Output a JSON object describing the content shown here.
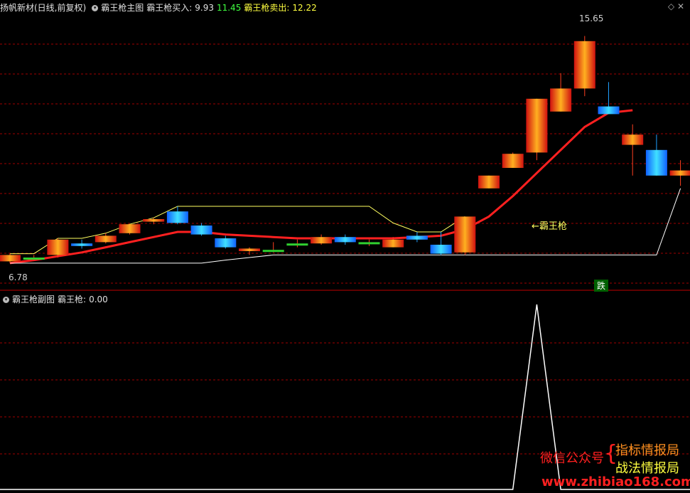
{
  "header": {
    "stock": "扬帆新材(日线,前复权)",
    "indicator": "霸王枪主图",
    "buy_label": "霸王枪买入:",
    "buy_value": "9.93",
    "mid_value": "11.45",
    "sell_label": "霸王枪卖出:",
    "sell_value": "12.22"
  },
  "sub_header": {
    "indicator": "霸王枪副图",
    "value_label": "霸王枪:",
    "value": "0.00"
  },
  "annotations": {
    "high": "15.65",
    "low": "6.78",
    "line_label": "←霸王枪",
    "signal": "跌"
  },
  "watermark": {
    "wechat": "微信公众号",
    "brand1": "指标情报局",
    "brand2": "战法情报局",
    "url": "www.zhibiao168.com"
  },
  "colors": {
    "up": "#ff3020",
    "down": "#20a0ff",
    "flat": "#30d030",
    "ma": "#ff2020",
    "white_line": "#ffffff",
    "yellow_line": "#ffff60",
    "grid": "#a00000"
  },
  "chart_data": {
    "type": "candlestick",
    "price_range": [
      6.0,
      16.5
    ],
    "candles": [
      {
        "o": 6.85,
        "h": 7.15,
        "l": 6.78,
        "c": 7.1
      },
      {
        "o": 7.0,
        "h": 7.1,
        "l": 6.9,
        "c": 7.0
      },
      {
        "o": 7.1,
        "h": 7.75,
        "l": 7.0,
        "c": 7.7
      },
      {
        "o": 7.55,
        "h": 7.7,
        "l": 7.35,
        "c": 7.45
      },
      {
        "o": 7.6,
        "h": 7.95,
        "l": 7.55,
        "c": 7.85
      },
      {
        "o": 7.95,
        "h": 8.3,
        "l": 7.9,
        "c": 8.3
      },
      {
        "o": 8.4,
        "h": 8.55,
        "l": 8.3,
        "c": 8.5
      },
      {
        "o": 8.8,
        "h": 9.0,
        "l": 8.3,
        "c": 8.35
      },
      {
        "o": 8.25,
        "h": 8.35,
        "l": 7.85,
        "c": 7.9
      },
      {
        "o": 7.75,
        "h": 7.85,
        "l": 7.35,
        "c": 7.4
      },
      {
        "o": 7.25,
        "h": 7.4,
        "l": 7.1,
        "c": 7.35
      },
      {
        "o": 7.3,
        "h": 7.6,
        "l": 7.2,
        "c": 7.3
      },
      {
        "o": 7.5,
        "h": 7.7,
        "l": 7.4,
        "c": 7.55
      },
      {
        "o": 7.55,
        "h": 7.9,
        "l": 7.5,
        "c": 7.8
      },
      {
        "o": 7.8,
        "h": 7.9,
        "l": 7.5,
        "c": 7.6
      },
      {
        "o": 7.6,
        "h": 7.7,
        "l": 7.45,
        "c": 7.6
      },
      {
        "o": 7.4,
        "h": 7.8,
        "l": 7.4,
        "c": 7.7
      },
      {
        "o": 7.85,
        "h": 8.0,
        "l": 7.6,
        "c": 7.7
      },
      {
        "o": 7.5,
        "h": 8.0,
        "l": 7.1,
        "c": 7.15
      },
      {
        "o": 7.2,
        "h": 8.6,
        "l": 7.1,
        "c": 8.6
      },
      {
        "o": 9.7,
        "h": 10.2,
        "l": 9.7,
        "c": 10.2
      },
      {
        "o": 10.5,
        "h": 11.1,
        "l": 10.5,
        "c": 11.05
      },
      {
        "o": 11.1,
        "h": 13.2,
        "l": 10.8,
        "c": 13.2
      },
      {
        "o": 12.7,
        "h": 14.2,
        "l": 12.7,
        "c": 13.6
      },
      {
        "o": 13.6,
        "h": 15.65,
        "l": 13.3,
        "c": 15.45
      },
      {
        "o": 12.9,
        "h": 13.85,
        "l": 12.6,
        "c": 12.6
      },
      {
        "o": 11.4,
        "h": 12.2,
        "l": 10.2,
        "c": 11.8
      },
      {
        "o": 11.2,
        "h": 11.8,
        "l": 10.2,
        "c": 10.2
      },
      {
        "o": 10.2,
        "h": 10.8,
        "l": 9.8,
        "c": 10.4
      }
    ],
    "ma_line": [
      6.78,
      6.9,
      7.05,
      7.2,
      7.4,
      7.6,
      7.8,
      8.0,
      8.0,
      7.9,
      7.85,
      7.8,
      7.75,
      7.75,
      7.75,
      7.75,
      7.75,
      7.8,
      7.85,
      8.1,
      8.6,
      9.4,
      10.3,
      11.2,
      12.1,
      12.65,
      12.75,
      null,
      null
    ],
    "sub_values": [
      0,
      0,
      0,
      0,
      0,
      0,
      0,
      0,
      0,
      0,
      0,
      0,
      0,
      0,
      0,
      0,
      0,
      0,
      0,
      0,
      0,
      0,
      1,
      0,
      0,
      0,
      0,
      0,
      0
    ]
  }
}
